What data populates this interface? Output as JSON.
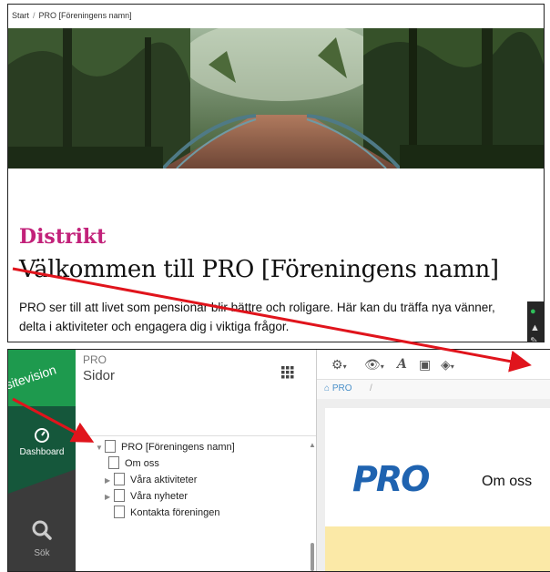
{
  "top": {
    "breadcrumb": {
      "start": "Start",
      "separator": "/",
      "current": "PRO [Föreningens namn]"
    },
    "district": "Distrikt",
    "welcome": "Välkommen till PRO [Föreningens namn]",
    "intro": "PRO ser till att livet som pensionär blir bättre och roligare. Här kan du träffa nya vänner, delta i aktiviteter och engagera dig i viktiga frågor.",
    "edit_icons": [
      "leaf-icon",
      "user-icon",
      "pencil-icon"
    ]
  },
  "cms": {
    "logo": "sitevision",
    "nav": [
      {
        "label": "Dashboard",
        "icon": "dashboard-icon"
      },
      {
        "label": "Sök",
        "icon": "search-icon"
      }
    ],
    "tree": {
      "site_label": "PRO",
      "title": "Sidor",
      "items": [
        {
          "label": "PRO [Föreningens namn]",
          "expanded": true,
          "level": 0
        },
        {
          "label": "Om oss",
          "level": 1
        },
        {
          "label": "Våra aktiviteter",
          "collapsed": true,
          "level": 1
        },
        {
          "label": "Våra nyheter",
          "collapsed": true,
          "level": 1
        },
        {
          "label": "Kontakta föreningen",
          "level": 1
        }
      ]
    },
    "breadcrumb": {
      "home": "PRO",
      "separator": "/"
    },
    "preview": {
      "logo": "PRO",
      "link": "Om oss"
    }
  },
  "colors": {
    "district": "#c2227a",
    "sitevision_green": "#1e9a4e",
    "dashboard_dark_green": "#15573b",
    "arrow_red": "#e0141c",
    "pro_blue": "#1f63b0"
  }
}
